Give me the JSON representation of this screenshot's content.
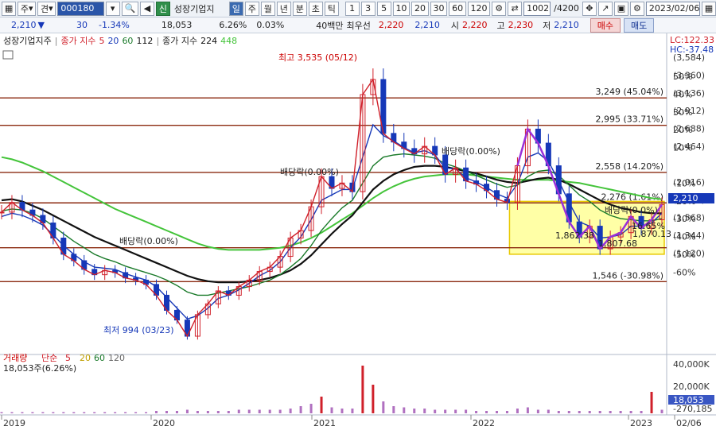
{
  "toolbar": {
    "market_label": "주",
    "type_label": "견",
    "code_value": "000180",
    "new_badge": "신",
    "stock_name": "성장기업지",
    "periods": [
      "일",
      "주",
      "월",
      "년",
      "분",
      "초",
      "틱"
    ],
    "active_period": "일",
    "minute_options": [
      "1",
      "3",
      "5",
      "10",
      "20",
      "30",
      "60",
      "120"
    ],
    "count_value": "1002",
    "count_total": "/4200",
    "date_value": "2023/02/06"
  },
  "price_bar": {
    "price": "2,210",
    "down_arrow": "▼",
    "change": "30",
    "change_pct": "-1.34%",
    "volume": "18,053",
    "turnover_pct": "6.26%",
    "extra_pct": "0.03%",
    "min_label": "40백만",
    "min_option": "최우선",
    "bid": "2,220",
    "ask": "2,210",
    "open_label": "시",
    "open": "2,220",
    "high_label": "고",
    "high": "2,230",
    "low_label": "저",
    "low": "2,210",
    "buy_label": "매수",
    "sell_label": "매도"
  },
  "legend": {
    "name": "성장기업지주",
    "ma_label": "종가 지수",
    "ma_periods": [
      "5",
      "20",
      "60",
      "112"
    ],
    "ma2_label": "종가 지수",
    "ma2_periods": [
      "224",
      "448"
    ],
    "lc": "LC:122.33",
    "hc": "HC:-37.48"
  },
  "volume_legend": {
    "title": "거래량",
    "type": "단순",
    "periods": [
      "5",
      "20",
      "60",
      "120"
    ],
    "current": "18,053주(6.26%)"
  },
  "colors": {
    "ma5": "#d0202a",
    "ma20": "#1638b8",
    "ma60": "#1a7a2a",
    "ma112": "#111111",
    "ma224": "#44c43a",
    "hline": "#8b2a10",
    "box": "#ffff88",
    "purple": "#9a30d8",
    "up": "#d0202a",
    "down": "#1638b8"
  },
  "chart_data": {
    "type": "candlestick",
    "x_labels": [
      "2019",
      "2020",
      "2021",
      "2022",
      "2023",
      "02/06"
    ],
    "y_right_price": [
      "(3,584)",
      "(3,360)",
      "(3,136)",
      "(2,912)",
      "(2,688)",
      "(2,464)",
      "(2,016)",
      "(1,792)",
      "(1,568)",
      "(1,344)",
      "(1,120)"
    ],
    "y_right_pct": [
      "50%",
      "40%",
      "30%",
      "20%",
      "10%",
      "-10%",
      "-20%",
      "-30%",
      "-40%",
      "-50%",
      "-60%"
    ],
    "current_price_tag": "2,210",
    "horizontal_levels": [
      {
        "price": 3249,
        "label": "3,249 (45.04%)"
      },
      {
        "price": 2995,
        "label": "2,995 (33.71%)"
      },
      {
        "price": 2558,
        "label": "2,558 (14.20%)"
      },
      {
        "price": 2276,
        "label": "2,276 (1.61%)"
      },
      {
        "price": 1860,
        "label": ""
      },
      {
        "price": 1546,
        "label": "1,546 (-30.98%)"
      }
    ],
    "high_annotation": "최고 3,535 (05/12)",
    "low_annotation": "최저 994 (03/23)",
    "dividend_labels": [
      "배당락(0.00%)",
      "배당락(0.00%)",
      "배당락(0.00%)",
      "배당락(0.0%)"
    ],
    "box_labels": [
      "1,862.38",
      "1,807.68",
      "1,870.13",
      "-16.65%"
    ],
    "volume_axis": [
      "40,000K",
      "20,000K",
      "18,053",
      "-270,185"
    ],
    "price_series": [
      2190,
      2280,
      2210,
      2160,
      2090,
      1950,
      1800,
      1740,
      1660,
      1610,
      1650,
      1630,
      1580,
      1560,
      1520,
      1420,
      1280,
      1190,
      1040,
      1240,
      1340,
      1460,
      1420,
      1500,
      1560,
      1640,
      1680,
      1780,
      1950,
      2020,
      2240,
      2520,
      2410,
      2460,
      2380,
      3280,
      3420,
      2920,
      2840,
      2780,
      2730,
      2800,
      2720,
      2540,
      2600,
      2480,
      2450,
      2390,
      2310,
      2280,
      2620,
      2960,
      2830,
      2620,
      2360,
      2100,
      1960,
      2060,
      1850,
      1960,
      2000,
      2150,
      2040,
      2120,
      2260
    ],
    "ma20_series": [
      2150,
      2180,
      2160,
      2120,
      2070,
      1980,
      1880,
      1800,
      1730,
      1680,
      1670,
      1660,
      1620,
      1590,
      1560,
      1500,
      1400,
      1300,
      1200,
      1230,
      1300,
      1390,
      1420,
      1470,
      1530,
      1600,
      1650,
      1730,
      1860,
      1960,
      2120,
      2300,
      2350,
      2400,
      2400,
      2700,
      3000,
      2900,
      2850,
      2790,
      2740,
      2760,
      2720,
      2600,
      2590,
      2510,
      2470,
      2420,
      2360,
      2320,
      2450,
      2700,
      2740,
      2660,
      2480,
      2280,
      2100,
      2060,
      1950,
      1960,
      1980,
      2060,
      2060,
      2090,
      2180
    ],
    "ma60_series": [
      2200,
      2220,
      2210,
      2180,
      2130,
      2060,
      1990,
      1920,
      1860,
      1800,
      1760,
      1730,
      1690,
      1660,
      1630,
      1600,
      1560,
      1510,
      1450,
      1420,
      1420,
      1440,
      1460,
      1480,
      1500,
      1530,
      1560,
      1610,
      1680,
      1760,
      1880,
      2020,
      2130,
      2230,
      2300,
      2460,
      2620,
      2700,
      2720,
      2730,
      2720,
      2710,
      2690,
      2640,
      2610,
      2570,
      2530,
      2490,
      2450,
      2420,
      2440,
      2520,
      2570,
      2580,
      2530,
      2440,
      2350,
      2290,
      2210,
      2160,
      2130,
      2120,
      2110,
      2110,
      2130
    ],
    "ma112_series": [
      2300,
      2310,
      2290,
      2250,
      2210,
      2160,
      2110,
      2060,
      2010,
      1960,
      1920,
      1880,
      1840,
      1800,
      1760,
      1720,
      1680,
      1640,
      1600,
      1570,
      1550,
      1540,
      1540,
      1540,
      1550,
      1560,
      1580,
      1610,
      1650,
      1710,
      1790,
      1890,
      1990,
      2080,
      2160,
      2280,
      2400,
      2480,
      2540,
      2580,
      2610,
      2620,
      2620,
      2610,
      2590,
      2570,
      2550,
      2520,
      2490,
      2470,
      2460,
      2480,
      2500,
      2510,
      2490,
      2450,
      2400,
      2350,
      2300,
      2260,
      2230,
      2210,
      2190,
      2180,
      2180
    ],
    "ma224_series": [
      2700,
      2680,
      2650,
      2610,
      2570,
      2520,
      2470,
      2420,
      2370,
      2320,
      2270,
      2220,
      2180,
      2140,
      2100,
      2060,
      2020,
      1980,
      1940,
      1900,
      1870,
      1850,
      1840,
      1840,
      1840,
      1840,
      1850,
      1860,
      1880,
      1910,
      1950,
      2000,
      2060,
      2120,
      2180,
      2250,
      2320,
      2380,
      2430,
      2470,
      2500,
      2520,
      2530,
      2540,
      2540,
      2540,
      2530,
      2520,
      2510,
      2500,
      2490,
      2490,
      2490,
      2490,
      2480,
      2470,
      2460,
      2440,
      2420,
      2400,
      2380,
      2360,
      2340,
      2320,
      2310
    ],
    "volume_series": [
      1,
      1,
      1,
      1,
      1,
      1,
      1,
      1,
      1,
      1,
      1,
      1,
      1,
      1,
      1,
      2,
      2,
      2,
      3,
      2,
      2,
      2,
      2,
      3,
      3,
      3,
      3,
      3,
      4,
      6,
      8,
      14,
      5,
      4,
      4,
      40,
      24,
      10,
      6,
      5,
      4,
      4,
      3,
      3,
      3,
      3,
      2,
      2,
      2,
      2,
      4,
      5,
      3,
      3,
      2,
      2,
      2,
      2,
      2,
      2,
      2,
      2,
      2,
      18,
      3
    ]
  }
}
